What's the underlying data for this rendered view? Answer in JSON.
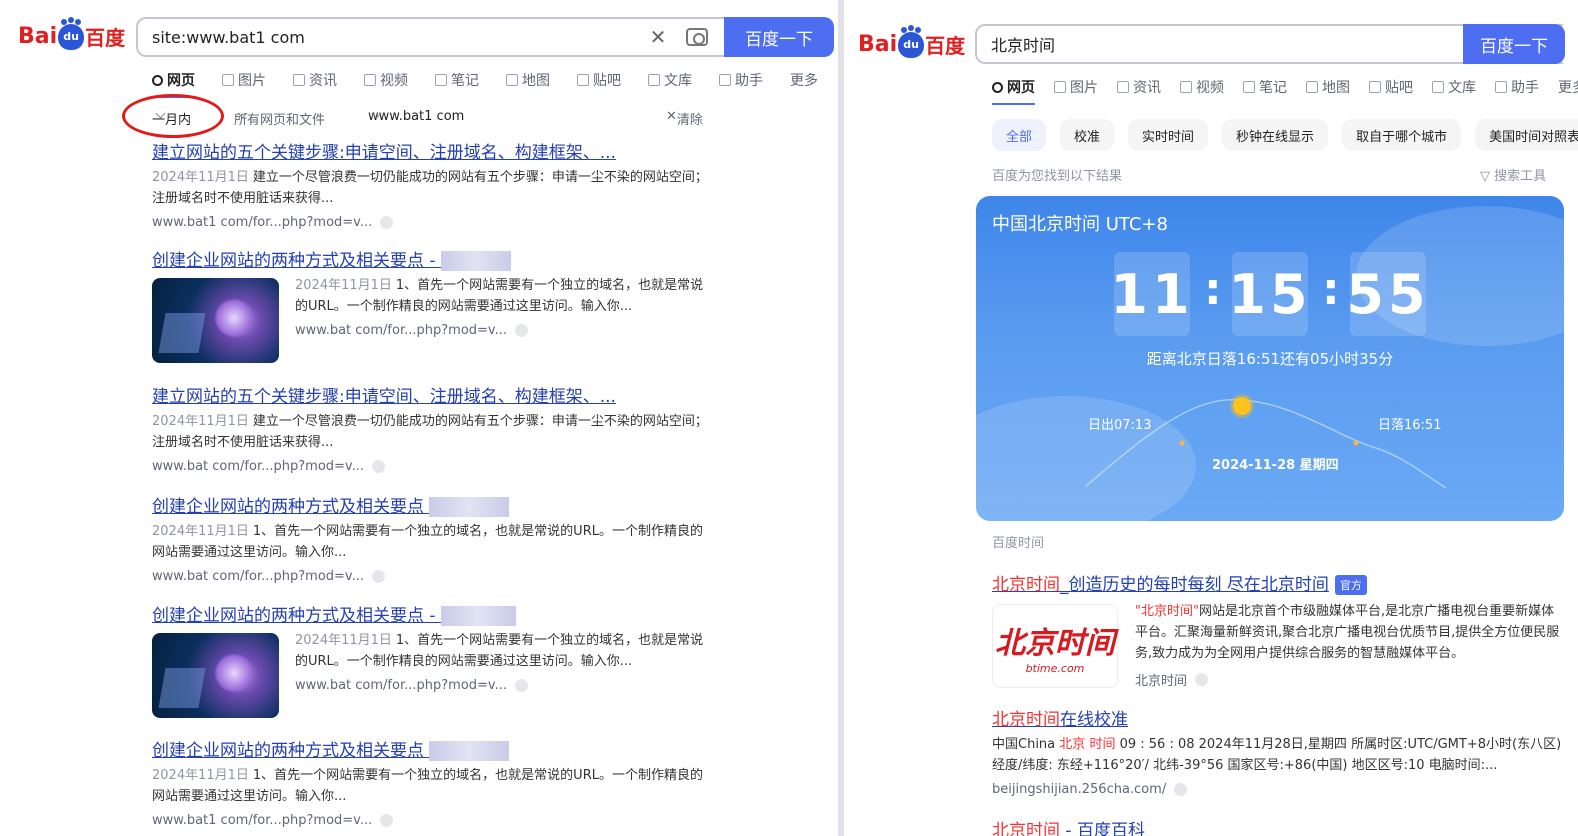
{
  "left": {
    "logo": {
      "bai": "Bai",
      "du": "du",
      "baidu": "百度"
    },
    "search": {
      "query": "site:www.bat1  com",
      "button": "百度一下"
    },
    "tabs": [
      "网页",
      "图片",
      "资讯",
      "视频",
      "笔记",
      "地图",
      "贴吧",
      "文库",
      "助手",
      "更多"
    ],
    "filters": {
      "time": "一月内",
      "type": "所有网页和文件",
      "site": "www.bat1    com",
      "clear": "清除"
    },
    "results": [
      {
        "title": "建立网站的五个关键步骤:申请空间、注册域名、构建框架、...",
        "date": "2024年11月1日",
        "desc": "建立一个尽管浪费一切仍能成功的网站有五个步骤：申请一尘不染的网站空间；注册域名时不使用脏话来获得...",
        "url": "www.bat1    com/for...php?mod=v..."
      },
      {
        "title": "创建企业网站的两种方式及相关要点 - ",
        "date": "2024年11月1日",
        "desc": "1、首先一个网站需要有一个独立的域名，也就是常说的URL。一个制作精良的网站需要通过这里访问。输入你...",
        "url": "www.bat    com/for...php?mod=v..."
      },
      {
        "title": "建立网站的五个关键步骤:申请空间、注册域名、构建框架、...",
        "date": "2024年11月1日",
        "desc": "建立一个尽管浪费一切仍能成功的网站有五个步骤：申请一尘不染的网站空间；注册域名时不使用脏话来获得...",
        "url": "www.bat    com/for...php?mod=v..."
      },
      {
        "title": "创建企业网站的两种方式及相关要点 ",
        "date": "2024年11月1日",
        "desc": "1、首先一个网站需要有一个独立的域名，也就是常说的URL。一个制作精良的网站需要通过这里访问。输入你...",
        "url": "www.bat    com/for...php?mod=v..."
      },
      {
        "title": "创建企业网站的两种方式及相关要点 - ",
        "date": "2024年11月1日",
        "desc": "1、首先一个网站需要有一个独立的域名，也就是常说的URL。一个制作精良的网站需要通过这里访问。输入你...",
        "url": "www.bat    com/for...php?mod=v..."
      },
      {
        "title": "创建企业网站的两种方式及相关要点 ",
        "date": "2024年11月1日",
        "desc": "1、首先一个网站需要有一个独立的域名，也就是常说的URL。一个制作精良的网站需要通过这里访问。输入你...",
        "url": "www.bat1    com/for...php?mod=v..."
      }
    ]
  },
  "right": {
    "search": {
      "query": "北京时间",
      "button": "百度一下"
    },
    "tabs": [
      "网页",
      "图片",
      "资讯",
      "视频",
      "笔记",
      "地图",
      "贴吧",
      "文库",
      "助手",
      "更多"
    ],
    "chips": [
      "全部",
      "校准",
      "实时时间",
      "秒钟在线显示",
      "取自于哪个城市",
      "美国时间对照表"
    ],
    "found": "百度为您找到以下结果",
    "tools": "搜索工具",
    "time_card": {
      "timezone": "中国北京时间 UTC+8",
      "hh": "11",
      "mm": "15",
      "ss": "55",
      "sep": ":",
      "sunset_note": "距离北京日落16:51还有05小时35分",
      "sunrise": "日出07:13",
      "sunset": "日落16:51",
      "date": "2024-11-28   星期四"
    },
    "source": "百度时间",
    "results": [
      {
        "title_hl": "北京时间",
        "title_rest": "_创造历史的每时每刻 尽在北京时间",
        "badge": "官方",
        "desc_q": "\"北京时间\"",
        "desc": "网站是北京首个市级融媒体平台,是北京广播电视台重要新媒体平台。汇聚海量新鲜资讯,聚合北京广播电视台优质节目,提供全方位便民服务,致力成为为全网用户提供综合服务的智慧融媒体平台。",
        "site": "北京时间",
        "logo_big": "北京时间",
        "logo_small": "btime.com"
      },
      {
        "title_hl": "北京时间",
        "title_rest": "在线校准",
        "desc_pre": "中国China ",
        "desc_hl1": "北京",
        "desc_hl2": "时间",
        "desc": " 09 : 56 : 08 2024年11月28日,星期四 所属时区:UTC/GMT+8小时(东八区) 经度/纬度: 东经+116°20′/ 北纬-39°56 国家区号:+86(中国) 地区区号:10 电脑时间:...",
        "url": "beijingshijian.256cha.com/"
      },
      {
        "title_hl": "北京时间",
        "title_rest": " - 百度百科"
      }
    ]
  }
}
